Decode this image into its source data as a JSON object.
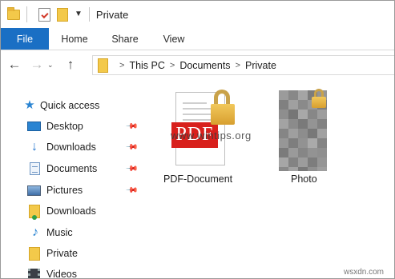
{
  "title_bar": {
    "title": "Private"
  },
  "ribbon": {
    "tabs": [
      "File",
      "Home",
      "Share",
      "View"
    ]
  },
  "address_bar": {
    "back_glyph": "←",
    "forward_glyph": "→",
    "recent_glyph": "⌄",
    "up_glyph": "↑",
    "breadcrumbs": [
      "This PC",
      "Documents",
      "Private"
    ]
  },
  "nav_pane": {
    "items": [
      {
        "label": "Quick access",
        "icon": "star-icon",
        "pinned": false
      },
      {
        "label": "Desktop",
        "icon": "desktop-icon",
        "pinned": true
      },
      {
        "label": "Downloads",
        "icon": "downloads-icon",
        "pinned": true
      },
      {
        "label": "Documents",
        "icon": "documents-icon",
        "pinned": true
      },
      {
        "label": "Pictures",
        "icon": "pictures-icon",
        "pinned": true
      },
      {
        "label": "Downloads",
        "icon": "folder-download-icon",
        "pinned": false
      },
      {
        "label": "Music",
        "icon": "music-icon",
        "pinned": false
      },
      {
        "label": "Private",
        "icon": "folder-icon",
        "pinned": false
      },
      {
        "label": "Videos",
        "icon": "videos-icon",
        "pinned": false
      }
    ]
  },
  "files": [
    {
      "name": "PDF-Document",
      "badge_text": "PDF",
      "icon": "pdf-file-icon",
      "locked": true
    },
    {
      "name": "Photo",
      "icon": "image-thumbnail",
      "locked": true
    }
  ],
  "watermark": "www.wintips.org",
  "credit": "wsxdn.com",
  "colors": {
    "file_tab": "#1a6fc4",
    "pdf_red": "#d8201c",
    "lock_gold": "#e2b443",
    "folder_yellow": "#f3c94a"
  }
}
